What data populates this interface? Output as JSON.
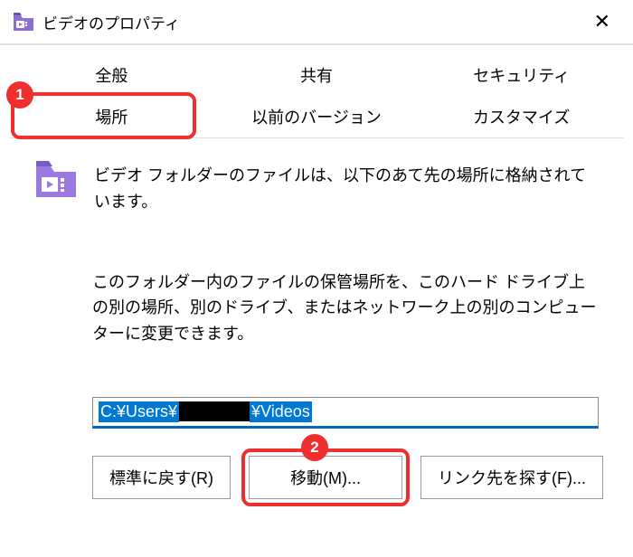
{
  "titlebar": {
    "title": "ビデオのプロパティ"
  },
  "tabs": {
    "row1": [
      {
        "label": "全般"
      },
      {
        "label": "共有"
      },
      {
        "label": "セキュリティ"
      }
    ],
    "row2": [
      {
        "label": "場所"
      },
      {
        "label": "以前のバージョン"
      },
      {
        "label": "カスタマイズ"
      }
    ]
  },
  "content": {
    "desc1": "ビデオ フォルダーのファイルは、以下のあて先の場所に格納されています。",
    "desc2": "このフォルダー内のファイルの保管場所を、このハード ドライブ上の別の場所、別のドライブ、またはネットワーク上の別のコンピューターに変更できます。",
    "path_prefix": "C:¥Users¥",
    "path_suffix": "¥Videos"
  },
  "buttons": {
    "restore": "標準に戻す(R)",
    "move": "移動(M)...",
    "findtarget": "リンク先を探す(F)..."
  },
  "annotations": {
    "tab_badge": "1",
    "move_badge": "2"
  }
}
